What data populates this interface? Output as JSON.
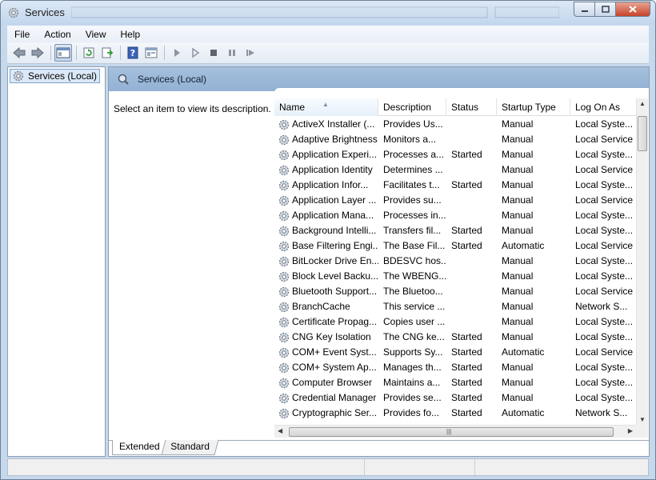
{
  "window": {
    "title": "Services"
  },
  "menu": [
    "File",
    "Action",
    "View",
    "Help"
  ],
  "toolbar": {
    "buttons": [
      "back-icon",
      "forward-icon",
      "show-hide-tree-icon",
      "refresh-icon",
      "export-list-icon",
      "help-icon",
      "mmc-properties-icon",
      "start-service-icon",
      "start-service-alt-icon",
      "stop-service-icon",
      "pause-service-icon",
      "restart-service-icon"
    ]
  },
  "tree": {
    "selected_label": "Services (Local)"
  },
  "main": {
    "header_title": "Services (Local)",
    "description_hint": "Select an item to view its description."
  },
  "table": {
    "columns": [
      "Name",
      "Description",
      "Status",
      "Startup Type",
      "Log On As"
    ],
    "rows": [
      [
        "ActiveX Installer (...",
        "Provides Us...",
        "",
        "Manual",
        "Local Syste..."
      ],
      [
        "Adaptive Brightness",
        "Monitors a...",
        "",
        "Manual",
        "Local Service"
      ],
      [
        "Application Experi...",
        "Processes a...",
        "Started",
        "Manual",
        "Local Syste..."
      ],
      [
        "Application Identity",
        "Determines ...",
        "",
        "Manual",
        "Local Service"
      ],
      [
        "Application Infor...",
        "Facilitates t...",
        "Started",
        "Manual",
        "Local Syste..."
      ],
      [
        "Application Layer ...",
        "Provides su...",
        "",
        "Manual",
        "Local Service"
      ],
      [
        "Application Mana...",
        "Processes in...",
        "",
        "Manual",
        "Local Syste..."
      ],
      [
        "Background Intelli...",
        "Transfers fil...",
        "Started",
        "Manual",
        "Local Syste..."
      ],
      [
        "Base Filtering Engi...",
        "The Base Fil...",
        "Started",
        "Automatic",
        "Local Service"
      ],
      [
        "BitLocker Drive En...",
        "BDESVC hos...",
        "",
        "Manual",
        "Local Syste..."
      ],
      [
        "Block Level Backu...",
        "The WBENG...",
        "",
        "Manual",
        "Local Syste..."
      ],
      [
        "Bluetooth Support...",
        "The Bluetoo...",
        "",
        "Manual",
        "Local Service"
      ],
      [
        "BranchCache",
        "This service ...",
        "",
        "Manual",
        "Network S..."
      ],
      [
        "Certificate Propag...",
        "Copies user ...",
        "",
        "Manual",
        "Local Syste..."
      ],
      [
        "CNG Key Isolation",
        "The CNG ke...",
        "Started",
        "Manual",
        "Local Syste..."
      ],
      [
        "COM+ Event Syst...",
        "Supports Sy...",
        "Started",
        "Automatic",
        "Local Service"
      ],
      [
        "COM+ System Ap...",
        "Manages th...",
        "Started",
        "Manual",
        "Local Syste..."
      ],
      [
        "Computer Browser",
        "Maintains a...",
        "Started",
        "Manual",
        "Local Syste..."
      ],
      [
        "Credential Manager",
        "Provides se...",
        "Started",
        "Manual",
        "Local Syste..."
      ],
      [
        "Cryptographic Ser...",
        "Provides fo...",
        "Started",
        "Automatic",
        "Network S..."
      ]
    ]
  },
  "tabs": [
    "Extended",
    "Standard"
  ],
  "colors": {
    "header_blue": "#9bb8d8",
    "frame": "#c5d8ec",
    "selection": "#dbe8f7"
  }
}
